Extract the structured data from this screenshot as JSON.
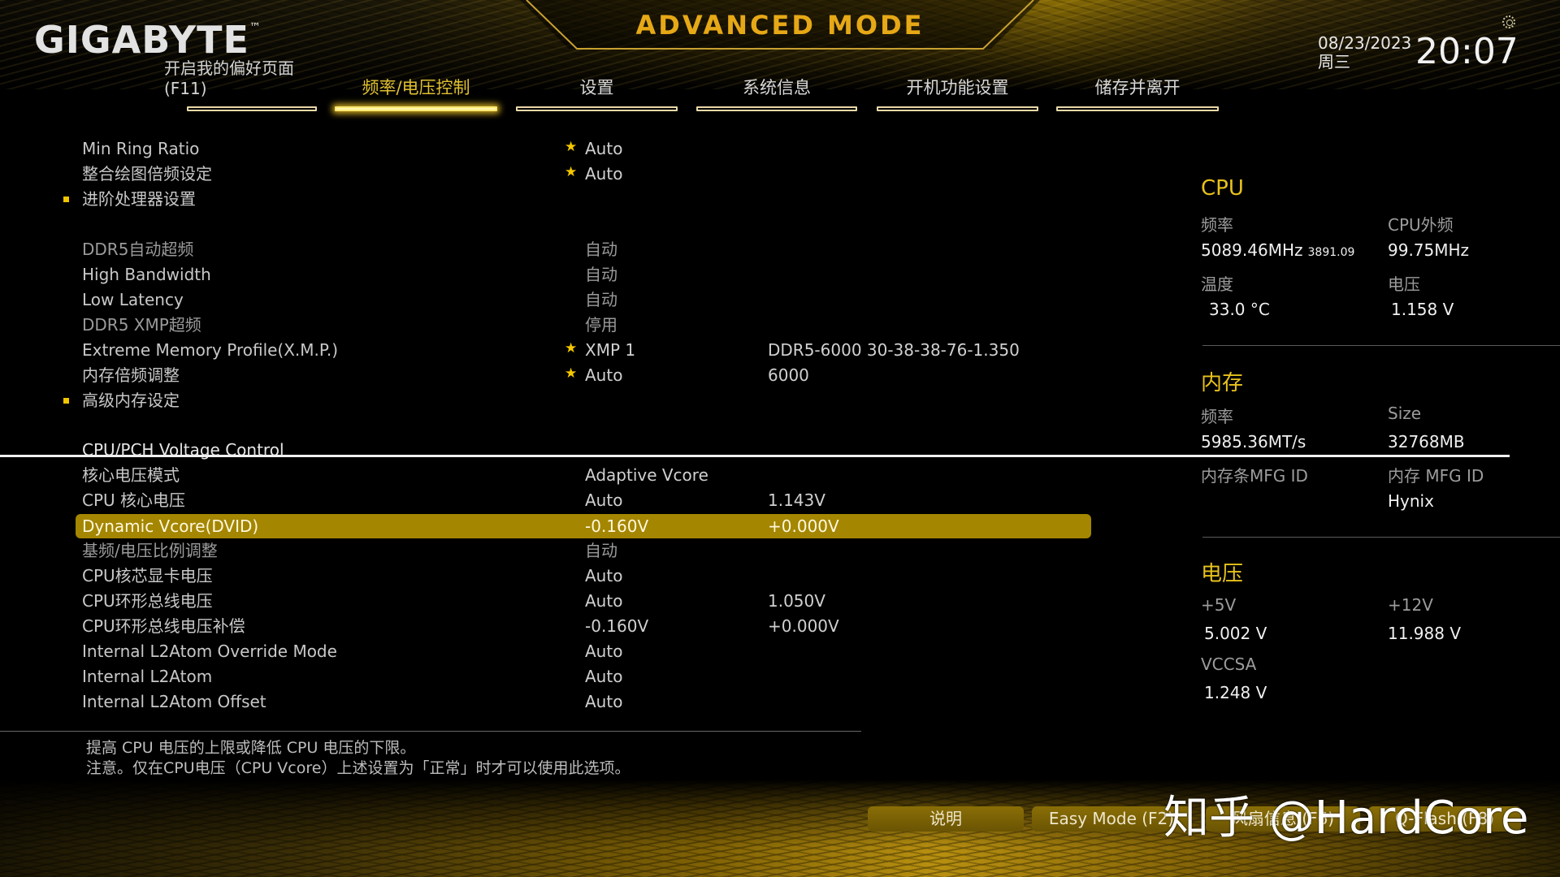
{
  "header": {
    "brand": "GIGABYTE",
    "brand_tm": "™",
    "mode_title": "ADVANCED MODE",
    "favorites_line1": "开启我的偏好页面",
    "favorites_line2": "(F11)",
    "date": "08/23/2023",
    "weekday": "周三",
    "time": "20:07",
    "settings_icon": "gear-icon"
  },
  "tabs": [
    {
      "label": "频率/电压控制",
      "active": true
    },
    {
      "label": "设置",
      "active": false
    },
    {
      "label": "系统信息",
      "active": false
    },
    {
      "label": "开机功能设置",
      "active": false
    },
    {
      "label": "储存并离开",
      "active": false
    }
  ],
  "settings": {
    "rows": [
      {
        "label": "Min Ring Ratio",
        "star": true,
        "value": "Auto",
        "value2": ""
      },
      {
        "label": "整合绘图倍频设定",
        "star": true,
        "value": "Auto",
        "value2": ""
      },
      {
        "label": "进阶处理器设置",
        "submenu": true,
        "value": "",
        "value2": ""
      },
      {
        "label": "DDR5自动超频",
        "value": "自动",
        "value2": "",
        "dim": true
      },
      {
        "label": "High Bandwidth",
        "value": "自动",
        "value2": "",
        "dim": true
      },
      {
        "label": "Low Latency",
        "value": "自动",
        "value2": "",
        "dim": true
      },
      {
        "label": "DDR5 XMP超频",
        "value": "停用",
        "value2": "",
        "dim": true
      },
      {
        "label": "Extreme Memory Profile(X.M.P.)",
        "star": true,
        "value": "XMP 1",
        "value2": "DDR5-6000 30-38-38-76-1.350"
      },
      {
        "label": "内存倍频调整",
        "star": true,
        "value": "Auto",
        "value2": "6000"
      },
      {
        "label": "高级内存设定",
        "submenu": true,
        "value": "",
        "value2": ""
      }
    ],
    "voltage_header": "CPU/PCH Voltage Control",
    "voltage_rows": [
      {
        "label": "核心电压模式",
        "value": "Adaptive Vcore",
        "value2": ""
      },
      {
        "label": "CPU 核心电压",
        "value": "Auto",
        "value2": "1.143V"
      },
      {
        "label": "Dynamic Vcore(DVID)",
        "value": "-0.160V",
        "value2": "+0.000V",
        "selected": true
      },
      {
        "label": "基频/电压比例调整",
        "value": "自动",
        "value2": "",
        "dim": true
      },
      {
        "label": "CPU核芯显卡电压",
        "value": "Auto",
        "value2": ""
      },
      {
        "label": "CPU环形总线电压",
        "value": "Auto",
        "value2": "1.050V"
      },
      {
        "label": "CPU环形总线电压补偿",
        "value": "-0.160V",
        "value2": "+0.000V"
      },
      {
        "label": "Internal L2Atom Override Mode",
        "value": "Auto",
        "value2": ""
      },
      {
        "label": "Internal L2Atom",
        "value": "Auto",
        "value2": ""
      },
      {
        "label": "Internal L2Atom Offset",
        "value": "Auto",
        "value2": ""
      }
    ]
  },
  "help": {
    "line1": "提高 CPU 电压的上限或降低 CPU 电压的下限。",
    "line2": "注意。仅在CPU电压（CPU Vcore）上述设置为「正常」时才可以使用此选项。"
  },
  "status_panel": {
    "cpu": {
      "title": "CPU",
      "freq_label": "频率",
      "freq_value": "5089.46MHz",
      "freq_sub": "3891.09",
      "bclk_label": "CPU外频",
      "bclk_value": "99.75MHz",
      "temp_label": "温度",
      "temp_value": "33.0 °C",
      "volt_label": "电压",
      "volt_value": "1.158 V"
    },
    "memory": {
      "title": "内存",
      "freq_label": "频率",
      "freq_value": "5985.36MT/s",
      "size_label": "Size",
      "size_value": "32768MB",
      "stick_mfg_label": "内存条MFG ID",
      "stick_mfg_value": "",
      "mfg_label": "内存 MFG ID",
      "mfg_value": "Hynix"
    },
    "voltage": {
      "title": "电压",
      "p5v_label": "+5V",
      "p5v_value": "5.002 V",
      "p12v_label": "+12V",
      "p12v_value": "11.988 V",
      "vccsa_label": "VCCSA",
      "vccsa_value": "1.248 V"
    }
  },
  "footer": {
    "buttons": [
      "说明",
      "Easy Mode (F2)",
      "风扇信息 (F6)",
      "Q-Flash (F8)"
    ],
    "watermark": "知乎 @HardCore"
  },
  "colors": {
    "accent": "#e8c21c",
    "selected_row": "#a48600",
    "mode_title": "#e6a816"
  }
}
